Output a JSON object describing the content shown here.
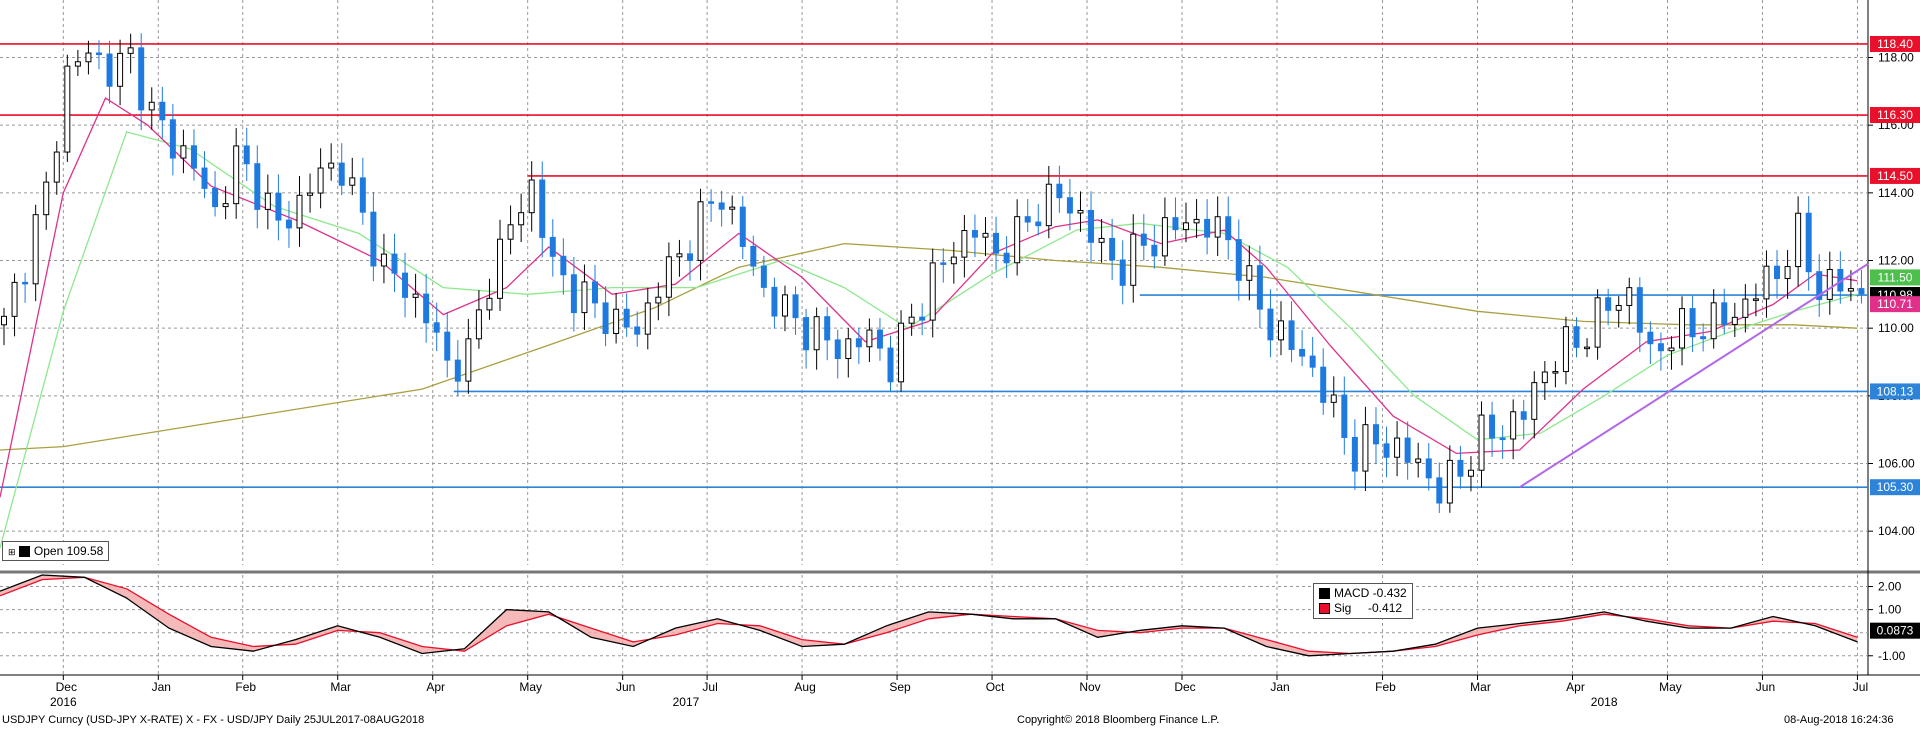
{
  "chart_data": [
    {
      "type": "candlestick",
      "ticker": "USDJPY Curncy",
      "ylim": [
        103.0,
        119.7
      ],
      "y_ticks": [
        "104.00",
        "106.00",
        "108.00",
        "110.00",
        "112.00",
        "114.00",
        "116.00",
        "118.00"
      ],
      "y_tick_values": [
        104,
        106,
        108,
        110,
        112,
        114,
        116,
        118
      ],
      "x_months": [
        "Dec",
        "Jan",
        "Feb",
        "Mar",
        "Apr",
        "May",
        "Jun",
        "Jul",
        "Aug",
        "Sep",
        "Oct",
        "Nov",
        "Dec",
        "Jan",
        "Feb",
        "Mar",
        "Apr",
        "May",
        "Jun",
        "Jul"
      ],
      "x_years": [
        "2016",
        "2017",
        "2018"
      ],
      "x_range_index": [
        0,
        140
      ],
      "month_index": [
        6,
        15,
        23,
        32,
        41,
        50,
        59,
        67,
        76,
        85,
        94,
        103,
        112,
        121,
        131,
        140,
        149,
        158,
        167,
        176
      ],
      "year_index": [
        6,
        65,
        152
      ],
      "ohlc_close_path": [
        [
          0,
          110.1
        ],
        [
          2,
          112.0
        ],
        [
          4,
          114.0
        ],
        [
          6,
          117.5
        ],
        [
          8,
          118.2
        ],
        [
          10,
          117.6
        ],
        [
          12,
          118.0
        ],
        [
          14,
          116.3
        ],
        [
          16,
          115.5
        ],
        [
          18,
          114.8
        ],
        [
          20,
          113.4
        ],
        [
          22,
          115.0
        ],
        [
          24,
          114.2
        ],
        [
          26,
          113.0
        ],
        [
          28,
          113.7
        ],
        [
          30,
          114.6
        ],
        [
          32,
          114.8
        ],
        [
          34,
          113.2
        ],
        [
          36,
          111.8
        ],
        [
          38,
          111.2
        ],
        [
          40,
          110.4
        ],
        [
          42,
          108.9
        ],
        [
          44,
          109.2
        ],
        [
          46,
          111.5
        ],
        [
          48,
          113.0
        ],
        [
          50,
          114.2
        ],
        [
          52,
          111.8
        ],
        [
          54,
          111.1
        ],
        [
          56,
          110.6
        ],
        [
          58,
          110.2
        ],
        [
          60,
          109.9
        ],
        [
          62,
          111.3
        ],
        [
          64,
          112.1
        ],
        [
          66,
          113.2
        ],
        [
          68,
          114.0
        ],
        [
          70,
          112.5
        ],
        [
          72,
          111.1
        ],
        [
          74,
          110.5
        ],
        [
          76,
          110.0
        ],
        [
          78,
          109.6
        ],
        [
          80,
          109.4
        ],
        [
          82,
          109.8
        ],
        [
          84,
          108.9
        ],
        [
          86,
          110.3
        ],
        [
          88,
          111.4
        ],
        [
          90,
          112.4
        ],
        [
          92,
          112.9
        ],
        [
          94,
          112.2
        ],
        [
          96,
          112.7
        ],
        [
          98,
          113.6
        ],
        [
          100,
          113.9
        ],
        [
          102,
          113.3
        ],
        [
          104,
          112.3
        ],
        [
          106,
          111.8
        ],
        [
          108,
          112.5
        ],
        [
          110,
          112.8
        ],
        [
          112,
          113.2
        ],
        [
          114,
          113.0
        ],
        [
          116,
          112.7
        ],
        [
          118,
          111.2
        ],
        [
          120,
          110.1
        ],
        [
          122,
          109.5
        ],
        [
          124,
          108.8
        ],
        [
          126,
          107.5
        ],
        [
          128,
          106.3
        ],
        [
          130,
          106.7
        ],
        [
          132,
          106.4
        ],
        [
          134,
          106.0
        ],
        [
          136,
          105.2
        ],
        [
          138,
          105.8
        ],
        [
          140,
          106.8
        ],
        [
          142,
          107.0
        ],
        [
          144,
          107.5
        ],
        [
          146,
          108.8
        ],
        [
          148,
          109.4
        ],
        [
          150,
          109.9
        ],
        [
          152,
          110.7
        ],
        [
          154,
          111.0
        ],
        [
          156,
          109.2
        ],
        [
          158,
          109.8
        ],
        [
          160,
          110.0
        ],
        [
          162,
          110.2
        ],
        [
          164,
          110.4
        ],
        [
          166,
          111.1
        ],
        [
          168,
          111.7
        ],
        [
          170,
          112.7
        ],
        [
          172,
          111.2
        ],
        [
          174,
          111.3
        ],
        [
          176,
          111.0
        ]
      ],
      "ma_fast_path": [
        [
          0,
          105
        ],
        [
          6,
          114
        ],
        [
          10,
          116.8
        ],
        [
          14,
          116.0
        ],
        [
          20,
          114.2
        ],
        [
          28,
          113.2
        ],
        [
          36,
          112.0
        ],
        [
          42,
          110.4
        ],
        [
          48,
          111.2
        ],
        [
          52,
          112.4
        ],
        [
          58,
          111.0
        ],
        [
          64,
          111.3
        ],
        [
          70,
          112.8
        ],
        [
          76,
          111.5
        ],
        [
          82,
          109.6
        ],
        [
          88,
          110.2
        ],
        [
          94,
          112.2
        ],
        [
          100,
          113.0
        ],
        [
          104,
          113.2
        ],
        [
          110,
          112.5
        ],
        [
          116,
          112.9
        ],
        [
          120,
          111.8
        ],
        [
          126,
          109.5
        ],
        [
          132,
          107.4
        ],
        [
          138,
          106.3
        ],
        [
          144,
          106.4
        ],
        [
          150,
          108.2
        ],
        [
          156,
          109.6
        ],
        [
          162,
          109.9
        ],
        [
          168,
          110.7
        ],
        [
          172,
          111.6
        ],
        [
          176,
          111.4
        ]
      ],
      "ma_mid_path": [
        [
          0,
          103.5
        ],
        [
          6,
          110.5
        ],
        [
          12,
          115.8
        ],
        [
          18,
          115.3
        ],
        [
          26,
          113.6
        ],
        [
          34,
          112.8
        ],
        [
          42,
          111.2
        ],
        [
          50,
          111.0
        ],
        [
          58,
          111.2
        ],
        [
          66,
          111.2
        ],
        [
          74,
          112.0
        ],
        [
          80,
          111.2
        ],
        [
          86,
          110.0
        ],
        [
          94,
          111.6
        ],
        [
          102,
          112.9
        ],
        [
          108,
          113.1
        ],
        [
          116,
          112.8
        ],
        [
          122,
          111.8
        ],
        [
          128,
          110.0
        ],
        [
          134,
          108.0
        ],
        [
          140,
          106.7
        ],
        [
          146,
          106.9
        ],
        [
          152,
          108.0
        ],
        [
          158,
          109.2
        ],
        [
          164,
          109.9
        ],
        [
          170,
          110.5
        ],
        [
          176,
          111.0
        ]
      ],
      "ma_slow_path": [
        [
          0,
          106.4
        ],
        [
          6,
          106.5
        ],
        [
          20,
          107.2
        ],
        [
          40,
          108.2
        ],
        [
          52,
          109.5
        ],
        [
          62,
          110.6
        ],
        [
          70,
          111.8
        ],
        [
          80,
          112.5
        ],
        [
          90,
          112.3
        ],
        [
          100,
          112.0
        ],
        [
          110,
          111.8
        ],
        [
          120,
          111.5
        ],
        [
          130,
          111.0
        ],
        [
          140,
          110.5
        ],
        [
          150,
          110.2
        ],
        [
          160,
          110.1
        ],
        [
          170,
          110.1
        ],
        [
          176,
          110.0
        ]
      ],
      "h_lines": [
        {
          "value": 118.4,
          "label": "118.40",
          "color": "#e8102a"
        },
        {
          "value": 116.3,
          "label": "116.30",
          "color": "#e8102a"
        },
        {
          "value": 114.5,
          "label": "114.50",
          "color": "#e8102a"
        },
        {
          "value": 110.98,
          "label": "110.98",
          "color": "#2d83d8"
        },
        {
          "value": 108.13,
          "label": "108.13",
          "color": "#2d83d8"
        },
        {
          "value": 105.3,
          "label": "105.30",
          "color": "#2d83d8"
        }
      ],
      "right_tags": [
        {
          "value": 118.4,
          "label": "118.40",
          "bg": "#e8102a"
        },
        {
          "value": 116.3,
          "label": "116.30",
          "bg": "#e8102a"
        },
        {
          "value": 114.5,
          "label": "114.50",
          "bg": "#e8102a"
        },
        {
          "value": 111.5,
          "label": "111.50",
          "bg": "#4cbf4c"
        },
        {
          "value": 110.98,
          "label": "110.98",
          "bg": "#000000"
        },
        {
          "value": 110.71,
          "label": "110.71",
          "bg": "#e0308a"
        },
        {
          "value": 108.13,
          "label": "108.13",
          "bg": "#2d83d8"
        },
        {
          "value": 105.3,
          "label": "105.30",
          "bg": "#2d83d8"
        }
      ],
      "trendline": {
        "from": [
          144,
          105.3
        ],
        "to": [
          176,
          111.4
        ],
        "color": "#b266e8"
      },
      "legend": {
        "label": "Open",
        "value": "109.58"
      },
      "colors": {
        "up": "#000000",
        "down": "#1f7ae0",
        "ma_fast": "#e0308a",
        "ma_mid": "#8de88d",
        "ma_slow": "#a8a040",
        "grid": "#999999"
      }
    },
    {
      "type": "line",
      "name": "MACD panel",
      "ylim": [
        -1.4,
        2.5
      ],
      "y_ticks": [
        "2.00",
        "1.00",
        "-1.00"
      ],
      "y_tick_values": [
        2,
        1,
        -1
      ],
      "current_tag": {
        "value": 0.0873,
        "label": "0.0873"
      },
      "series": [
        {
          "name": "MACD",
          "value": "-0.432",
          "color": "#000000",
          "points": [
            [
              0,
              1.8
            ],
            [
              4,
              2.5
            ],
            [
              8,
              2.4
            ],
            [
              12,
              1.5
            ],
            [
              16,
              0.2
            ],
            [
              20,
              -0.6
            ],
            [
              24,
              -0.8
            ],
            [
              28,
              -0.3
            ],
            [
              32,
              0.3
            ],
            [
              36,
              -0.2
            ],
            [
              40,
              -0.9
            ],
            [
              44,
              -0.7
            ],
            [
              48,
              1.0
            ],
            [
              52,
              0.9
            ],
            [
              56,
              -0.2
            ],
            [
              60,
              -0.6
            ],
            [
              64,
              0.2
            ],
            [
              68,
              0.6
            ],
            [
              72,
              0.1
            ],
            [
              76,
              -0.6
            ],
            [
              80,
              -0.5
            ],
            [
              84,
              0.3
            ],
            [
              88,
              0.9
            ],
            [
              92,
              0.8
            ],
            [
              96,
              0.6
            ],
            [
              100,
              0.6
            ],
            [
              104,
              -0.2
            ],
            [
              108,
              0.1
            ],
            [
              112,
              0.3
            ],
            [
              116,
              0.2
            ],
            [
              120,
              -0.6
            ],
            [
              124,
              -1.0
            ],
            [
              128,
              -0.9
            ],
            [
              132,
              -0.8
            ],
            [
              136,
              -0.5
            ],
            [
              140,
              0.2
            ],
            [
              144,
              0.4
            ],
            [
              148,
              0.6
            ],
            [
              152,
              0.9
            ],
            [
              156,
              0.5
            ],
            [
              160,
              0.2
            ],
            [
              164,
              0.2
            ],
            [
              168,
              0.7
            ],
            [
              172,
              0.3
            ],
            [
              176,
              -0.4
            ]
          ]
        },
        {
          "name": "Sig",
          "value": "-0.412",
          "color": "#e8102a",
          "points": [
            [
              0,
              1.6
            ],
            [
              4,
              2.3
            ],
            [
              8,
              2.4
            ],
            [
              12,
              1.9
            ],
            [
              16,
              0.8
            ],
            [
              20,
              -0.2
            ],
            [
              24,
              -0.6
            ],
            [
              28,
              -0.5
            ],
            [
              32,
              0.1
            ],
            [
              36,
              0.0
            ],
            [
              40,
              -0.6
            ],
            [
              44,
              -0.8
            ],
            [
              48,
              0.3
            ],
            [
              52,
              0.8
            ],
            [
              56,
              0.2
            ],
            [
              60,
              -0.4
            ],
            [
              64,
              -0.1
            ],
            [
              68,
              0.4
            ],
            [
              72,
              0.3
            ],
            [
              76,
              -0.3
            ],
            [
              80,
              -0.5
            ],
            [
              84,
              0.0
            ],
            [
              88,
              0.6
            ],
            [
              92,
              0.8
            ],
            [
              96,
              0.7
            ],
            [
              100,
              0.6
            ],
            [
              104,
              0.1
            ],
            [
              108,
              0.0
            ],
            [
              112,
              0.2
            ],
            [
              116,
              0.2
            ],
            [
              120,
              -0.3
            ],
            [
              124,
              -0.8
            ],
            [
              128,
              -0.9
            ],
            [
              132,
              -0.8
            ],
            [
              136,
              -0.6
            ],
            [
              140,
              -0.1
            ],
            [
              144,
              0.3
            ],
            [
              148,
              0.5
            ],
            [
              152,
              0.8
            ],
            [
              156,
              0.6
            ],
            [
              160,
              0.3
            ],
            [
              164,
              0.2
            ],
            [
              168,
              0.5
            ],
            [
              172,
              0.4
            ],
            [
              176,
              -0.2
            ]
          ]
        }
      ]
    }
  ],
  "footer": {
    "left": "USDJPY Curncy (USD-JPY X-RATE) X - FX - USD/JPY  Daily 25JUL2017-08AUG2018",
    "center": "Copyright© 2018 Bloomberg Finance L.P.",
    "right": "08-Aug-2018 16:24:36"
  }
}
